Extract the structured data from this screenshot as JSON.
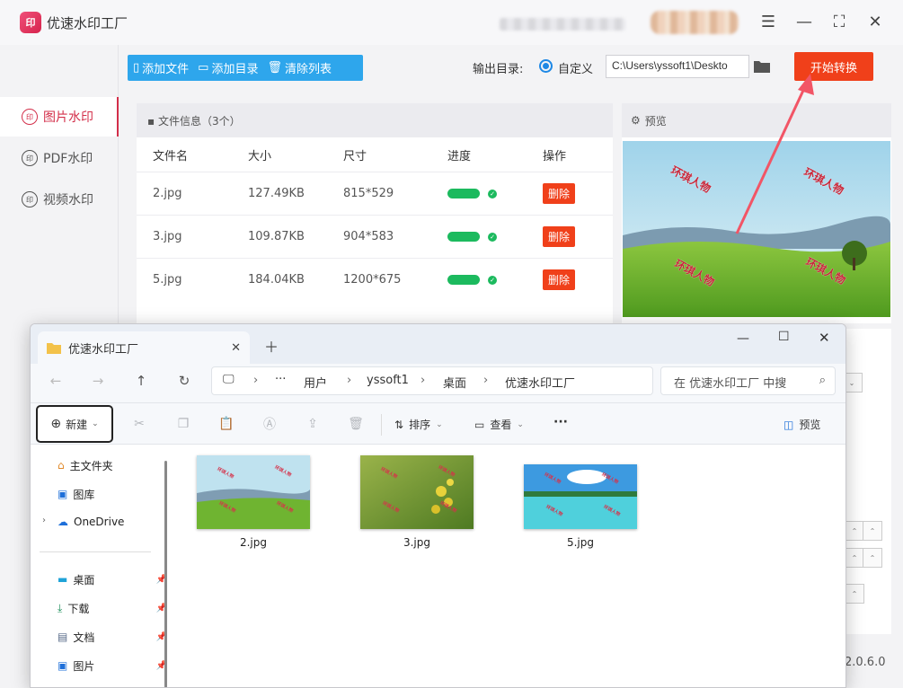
{
  "app": {
    "title": "优速水印工厂",
    "logo_text": "印",
    "version": "2.0.6.0"
  },
  "sidebar": {
    "items": [
      {
        "label": "图片水印",
        "active": true
      },
      {
        "label": "PDF水印",
        "active": false
      },
      {
        "label": "视频水印",
        "active": false
      }
    ]
  },
  "toolbar": {
    "add_file": "添加文件",
    "add_dir": "添加目录",
    "clear_list": "清除列表",
    "output_label": "输出目录:",
    "radio_label": "自定义",
    "output_path": "C:\\Users\\yssoft1\\Deskto",
    "start": "开始转换"
  },
  "file_panel": {
    "header": "文件信息（3个）",
    "columns": [
      "文件名",
      "大小",
      "尺寸",
      "进度",
      "操作"
    ],
    "rows": [
      {
        "name": "2.jpg",
        "size": "127.49KB",
        "dims": "815*529",
        "action": "删除"
      },
      {
        "name": "3.jpg",
        "size": "109.87KB",
        "dims": "904*583",
        "action": "删除"
      },
      {
        "name": "5.jpg",
        "size": "184.04KB",
        "dims": "1200*675",
        "action": "删除"
      }
    ]
  },
  "preview": {
    "header": "预览",
    "watermark": "环琪人物"
  },
  "explorer": {
    "tab_title": "优速水印工厂",
    "breadcrumb": [
      "用户",
      "yssoft1",
      "桌面",
      "优速水印工厂"
    ],
    "search_placeholder": "在 优速水印工厂 中搜",
    "cmd": {
      "new": "新建",
      "sort": "排序",
      "view": "查看",
      "more": "···",
      "preview": "预览"
    },
    "nav": [
      {
        "label": "主文件夹",
        "icon": "home-icon"
      },
      {
        "label": "图库",
        "icon": "gallery-icon"
      },
      {
        "label": "OneDrive",
        "icon": "cloud-icon"
      },
      {
        "label": "桌面",
        "icon": "desktop-icon"
      },
      {
        "label": "下载",
        "icon": "download-icon"
      },
      {
        "label": "文档",
        "icon": "document-icon"
      },
      {
        "label": "图片",
        "icon": "pictures-icon"
      }
    ],
    "files": [
      "2.jpg",
      "3.jpg",
      "5.jpg"
    ]
  }
}
